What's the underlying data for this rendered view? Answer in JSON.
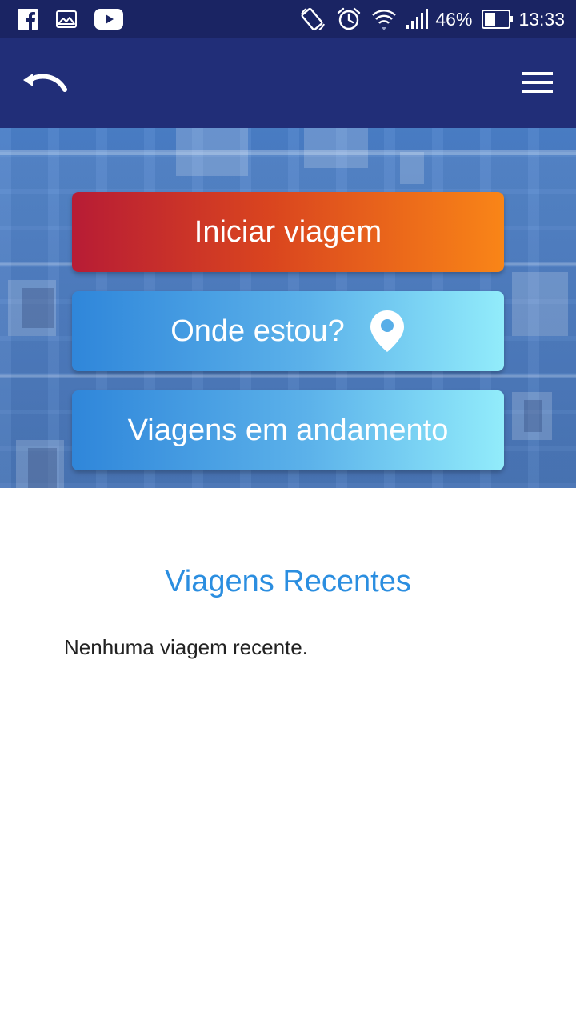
{
  "status_bar": {
    "left_icons": [
      "facebook-icon",
      "gallery-icon",
      "youtube-icon"
    ],
    "right_icons": [
      "rotation-icon",
      "alarm-icon",
      "wifi-icon",
      "signal-icon"
    ],
    "battery_percent": "46%",
    "time": "13:33"
  },
  "app_bar": {
    "back_icon": "back-arrow-icon",
    "menu_icon": "hamburger-menu-icon"
  },
  "actions": {
    "start_trip": "Iniciar viagem",
    "where_am_i": "Onde estou?",
    "where_am_i_icon": "location-pin-icon",
    "ongoing_trips": "Viagens em andamento"
  },
  "recent": {
    "title": "Viagens Recentes",
    "empty_message": "Nenhuma viagem recente."
  },
  "colors": {
    "status_bar": "#1a2463",
    "app_bar": "#212e78",
    "start_gradient": [
      "#b71c35",
      "#f98517"
    ],
    "secondary_gradient": [
      "#2f86da",
      "#92ecfb"
    ],
    "recent_title": "#2b8ee0"
  }
}
